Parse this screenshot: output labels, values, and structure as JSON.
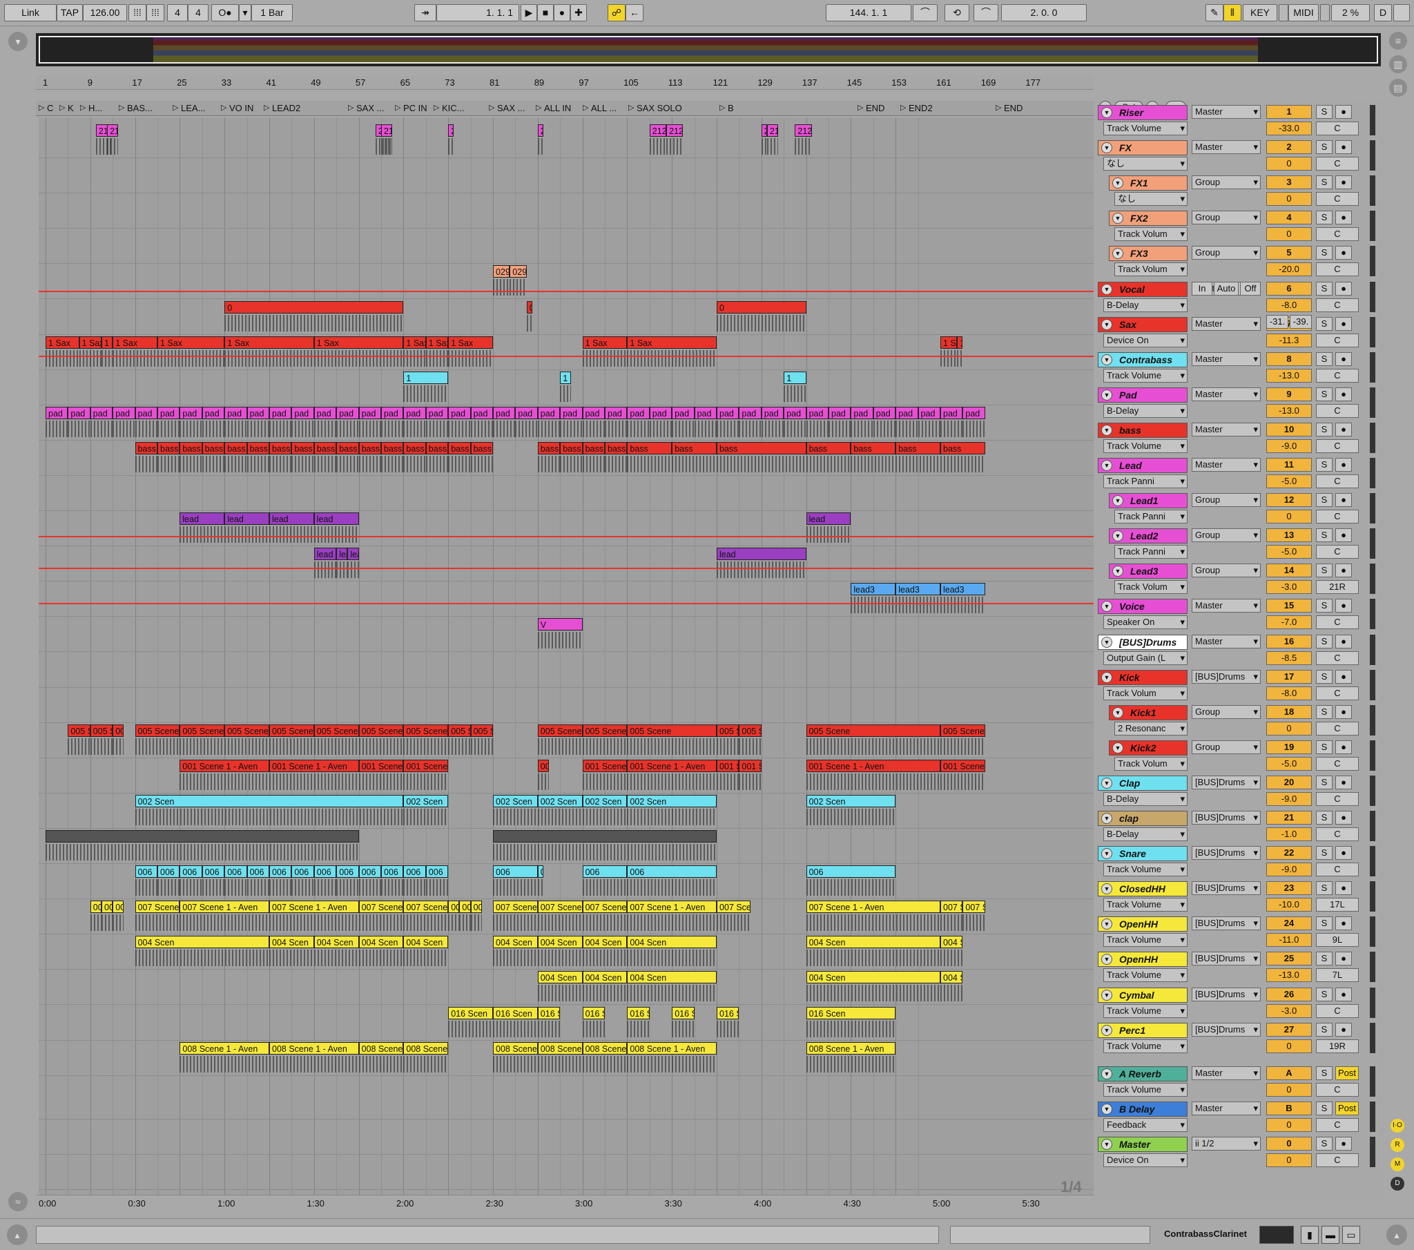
{
  "transport": {
    "link": "Link",
    "tap": "TAP",
    "tempo": "126.00",
    "signature_num": "4",
    "signature_den": "4",
    "quantize": "1 Bar",
    "position": "1.   1.   1",
    "loop_start": "144.   1.   1",
    "loop_length": "2.   0.   0",
    "key": "KEY",
    "midi": "MIDI",
    "cpu": "2 %",
    "d": "D"
  },
  "ruler": [
    "1",
    "9",
    "17",
    "25",
    "33",
    "41",
    "49",
    "57",
    "65",
    "73",
    "81",
    "89",
    "97",
    "105",
    "113",
    "121",
    "129",
    "137",
    "145",
    "153",
    "161",
    "169",
    "177"
  ],
  "locators": [
    "C",
    "K",
    "H...",
    "BAS...",
    "LEA...",
    "VO IN",
    "LEAD2",
    "SAX ...",
    "PC IN",
    "KIC...",
    "SAX ...",
    "ALL IN",
    "ALL ...",
    "SAX SOLO",
    "B",
    "END",
    "END2",
    "END"
  ],
  "time_ruler": [
    "0:00",
    "0:30",
    "1:00",
    "1:30",
    "2:00",
    "2:30",
    "3:00",
    "3:30",
    "4:00",
    "4:30",
    "5:00",
    "5:30"
  ],
  "page_indicator": "1/4",
  "tracks": [
    {
      "name": "Riser",
      "color": "#e64fd4",
      "device": "Track Volume",
      "out": "Master",
      "num": "1",
      "vol": "-33.0",
      "pan": "C"
    },
    {
      "name": "FX",
      "color": "#f2a07a",
      "device": "なし",
      "out": "Master",
      "num": "2",
      "vol": "0",
      "pan": "C"
    },
    {
      "name": "FX1",
      "color": "#f2a07a",
      "device": "なし",
      "out": "Group",
      "num": "3",
      "vol": "0",
      "pan": "C"
    },
    {
      "name": "FX2",
      "color": "#f2a07a",
      "device": "Track Volum",
      "out": "Group",
      "num": "4",
      "vol": "0",
      "pan": "C"
    },
    {
      "name": "FX3",
      "color": "#f2a07a",
      "device": "Track Volum",
      "out": "Group",
      "num": "5",
      "vol": "-20.0",
      "pan": "C"
    },
    {
      "name": "Vocal",
      "color": "#e8332b",
      "device": "B-Delay",
      "out": "Master",
      "num": "6",
      "vol": "-8.0",
      "pan": "C"
    },
    {
      "name": "Sax",
      "color": "#e8332b",
      "device": "Device On",
      "out": "Master",
      "num": "7",
      "vol": "-11.3",
      "pan": "C"
    },
    {
      "name": "Contrabass",
      "color": "#6fe0f0",
      "device": "Track Volume",
      "out": "Master",
      "num": "8",
      "vol": "-13.0",
      "pan": "C"
    },
    {
      "name": "Pad",
      "color": "#e64fd4",
      "device": "B-Delay",
      "out": "Master",
      "num": "9",
      "vol": "-13.0",
      "pan": "C"
    },
    {
      "name": "bass",
      "color": "#e8332b",
      "device": "Track Volume",
      "out": "Master",
      "num": "10",
      "vol": "-9.0",
      "pan": "C"
    },
    {
      "name": "Lead",
      "color": "#e64fd4",
      "device": "Track Panni",
      "out": "Master",
      "num": "11",
      "vol": "-5.0",
      "pan": "C"
    },
    {
      "name": "Lead1",
      "color": "#e64fd4",
      "device": "Track Panni",
      "out": "Group",
      "num": "12",
      "vol": "0",
      "pan": "C"
    },
    {
      "name": "Lead2",
      "color": "#e64fd4",
      "device": "Track Panni",
      "out": "Group",
      "num": "13",
      "vol": "-5.0",
      "pan": "C"
    },
    {
      "name": "Lead3",
      "color": "#e64fd4",
      "device": "Track Volum",
      "out": "Group",
      "num": "14",
      "vol": "-3.0",
      "pan": "21R"
    },
    {
      "name": "Voice",
      "color": "#e64fd4",
      "device": "Speaker On",
      "out": "Master",
      "num": "15",
      "vol": "-7.0",
      "pan": "C"
    },
    {
      "name": "[BUS]Drums",
      "color": "#ffffff",
      "device": "Output Gain (L",
      "out": "Master",
      "num": "16",
      "vol": "-8.5",
      "pan": "C"
    },
    {
      "name": "Kick",
      "color": "#e8332b",
      "device": "Track Volum",
      "out": "[BUS]Drums",
      "num": "17",
      "vol": "-8.0",
      "pan": "C"
    },
    {
      "name": "Kick1",
      "color": "#e8332b",
      "device": "2 Resonanc",
      "out": "Group",
      "num": "18",
      "vol": "0",
      "pan": "C"
    },
    {
      "name": "Kick2",
      "color": "#e8332b",
      "device": "Track Volum",
      "out": "Group",
      "num": "19",
      "vol": "-5.0",
      "pan": "C"
    },
    {
      "name": "Clap",
      "color": "#6fe0f0",
      "device": "B-Delay",
      "out": "[BUS]Drums",
      "num": "20",
      "vol": "-9.0",
      "pan": "C"
    },
    {
      "name": "clap",
      "color": "#c8a86a",
      "device": "B-Delay",
      "out": "[BUS]Drums",
      "num": "21",
      "vol": "-1.0",
      "pan": "C"
    },
    {
      "name": "Snare",
      "color": "#6fe0f0",
      "device": "Track Volume",
      "out": "[BUS]Drums",
      "num": "22",
      "vol": "-9.0",
      "pan": "C"
    },
    {
      "name": "ClosedHH",
      "color": "#f5e83a",
      "device": "Track Volume",
      "out": "[BUS]Drums",
      "num": "23",
      "vol": "-10.0",
      "pan": "17L"
    },
    {
      "name": "OpenHH",
      "color": "#f5e83a",
      "device": "Track Volume",
      "out": "[BUS]Drums",
      "num": "24",
      "vol": "-11.0",
      "pan": "9L"
    },
    {
      "name": "OpenHH",
      "color": "#f5e83a",
      "device": "Track Volume",
      "out": "[BUS]Drums",
      "num": "25",
      "vol": "-13.0",
      "pan": "7L"
    },
    {
      "name": "Cymbal",
      "color": "#f5e83a",
      "device": "Track Volume",
      "out": "[BUS]Drums",
      "num": "26",
      "vol": "-3.0",
      "pan": "C"
    },
    {
      "name": "Perc1",
      "color": "#f5e83a",
      "device": "Track Volume",
      "out": "[BUS]Drums",
      "num": "27",
      "vol": "0",
      "pan": "19R"
    }
  ],
  "returns": [
    {
      "name": "A Reverb",
      "color": "#4fb09a",
      "device": "Track Volume",
      "out": "Master",
      "num": "A",
      "vol": "0",
      "pan": "C",
      "post": "Post"
    },
    {
      "name": "B Delay",
      "color": "#3d7fd8",
      "device": "Feedback",
      "out": "Master",
      "num": "B",
      "vol": "0",
      "pan": "C",
      "post": "Post"
    },
    {
      "name": "Master",
      "color": "#8fd14f",
      "device": "Device On",
      "out": "ii 1/2",
      "num": "0",
      "vol": "0",
      "pan": "C",
      "post": ""
    }
  ],
  "vocal_io": {
    "in": "In",
    "auto": "Auto",
    "off": "Off",
    "r1": "-31.",
    "r2": "-39."
  },
  "status": {
    "device_name": "ContrabassClarinet"
  }
}
